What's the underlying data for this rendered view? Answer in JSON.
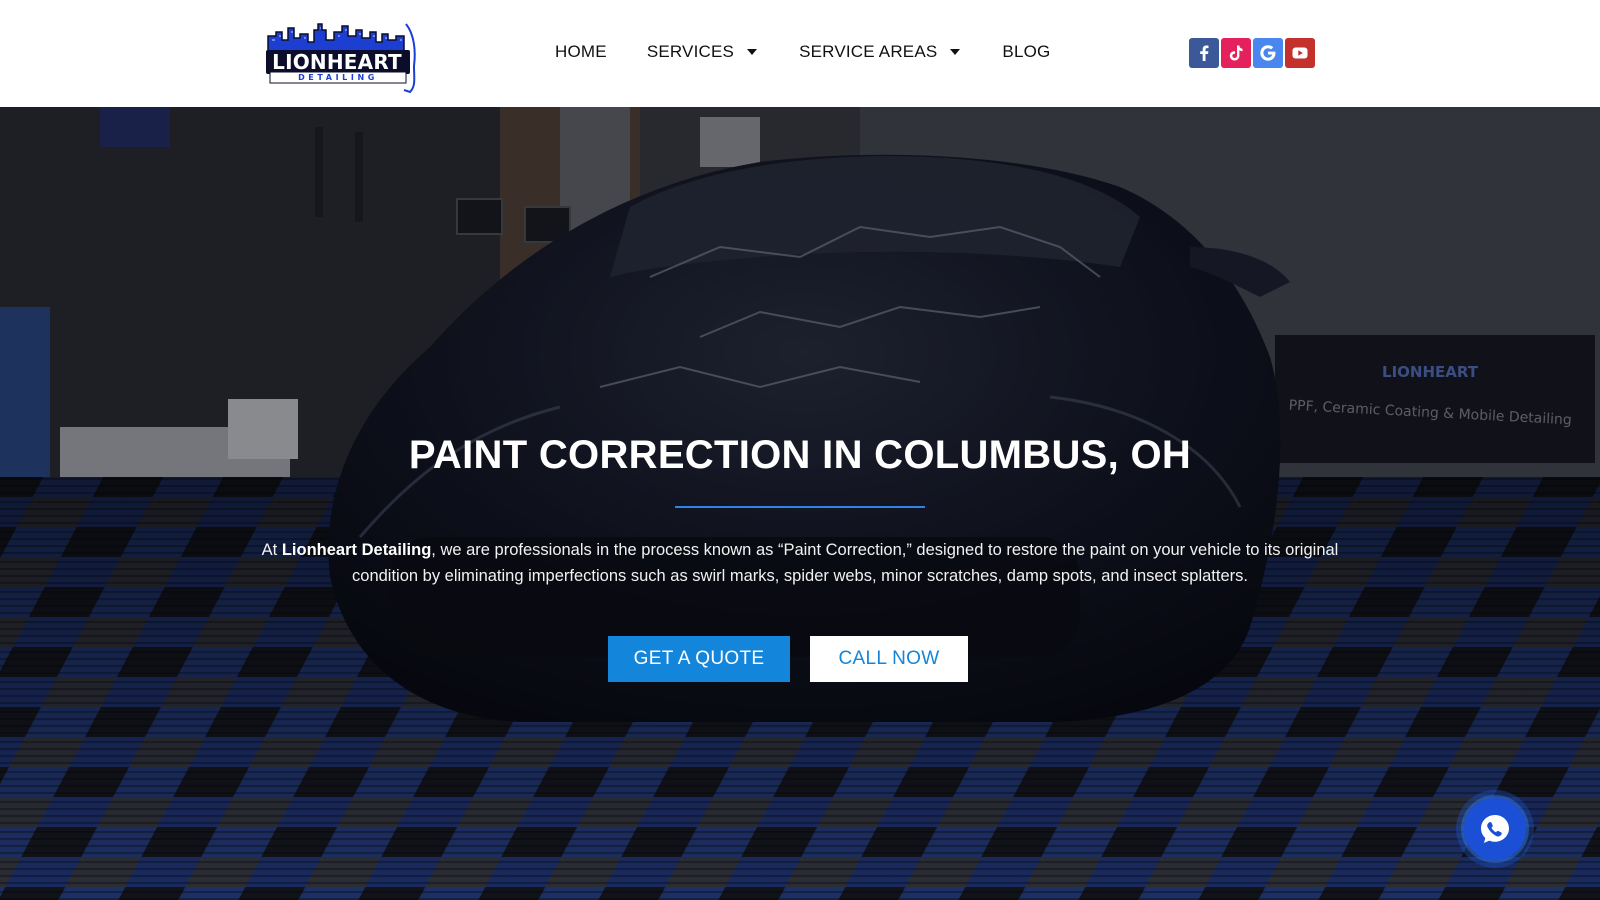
{
  "brand": {
    "name": "LIONHEART",
    "tagline": "DETAILING",
    "colors": {
      "primary_blue": "#1c3fd1",
      "navy": "#0b0d2a",
      "accent": "#1386dc"
    }
  },
  "nav": {
    "items": [
      {
        "label": "HOME",
        "has_dropdown": false
      },
      {
        "label": "SERVICES",
        "has_dropdown": true
      },
      {
        "label": "SERVICE AREAS",
        "has_dropdown": true
      },
      {
        "label": "BLOG",
        "has_dropdown": false
      }
    ]
  },
  "socials": [
    {
      "name": "facebook",
      "icon": "facebook-icon",
      "glyph": "f",
      "color": "#3b5998"
    },
    {
      "name": "tiktok",
      "icon": "tiktok-icon",
      "glyph": "♪",
      "color": "#e4215c"
    },
    {
      "name": "google",
      "icon": "google-icon",
      "glyph": "G",
      "color": "#4a86f0"
    },
    {
      "name": "youtube",
      "icon": "youtube-icon",
      "glyph": "▶",
      "color": "#c4302b"
    }
  ],
  "hero": {
    "title": "PAINT CORRECTION IN COLUMBUS, OH",
    "text_prefix": "At ",
    "text_brand": "Lionheart Detailing",
    "text_body": ", we are professionals in the process known as “Paint Correction,” designed to restore the paint on your vehicle to its original condition by eliminating imperfections such as swirl marks, spider webs, minor scratches, damp spots, and insect splatters.",
    "buttons": {
      "quote": "GET A QUOTE",
      "call": "CALL NOW"
    },
    "banner_brand": "LIONHEART",
    "banner_text": "PPF, Ceramic Coating & Mobile Detailing"
  },
  "chat": {
    "icon": "chat-icon"
  }
}
